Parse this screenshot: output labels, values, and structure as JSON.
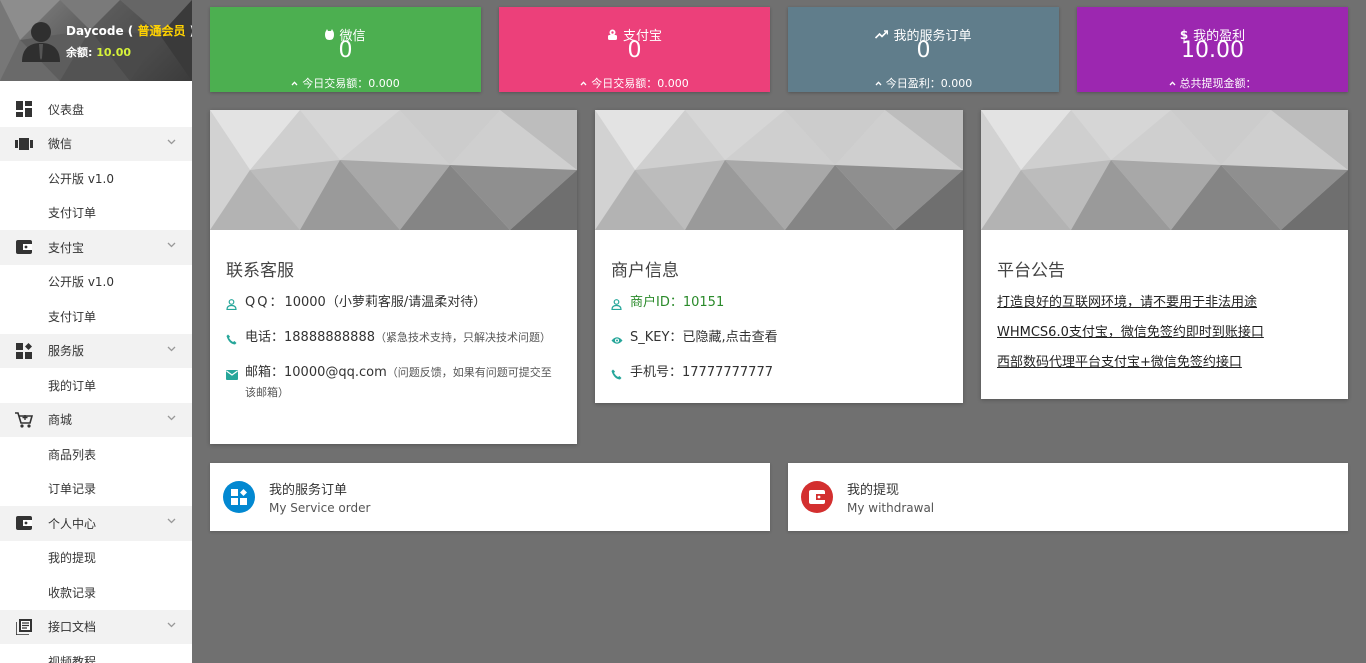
{
  "user": {
    "name": "Daycode",
    "paren_open": " ( ",
    "level": "普通会员",
    "paren_close": " )",
    "balance_label": "余额: ",
    "balance_value": "10.00"
  },
  "sidebar": {
    "items": [
      {
        "label": "仪表盘",
        "icon": "dashboard-icon"
      },
      {
        "label": "微信",
        "icon": "wechat-icon"
      },
      {
        "label": "公开版 v1.0"
      },
      {
        "label": "支付订单"
      },
      {
        "label": "支付宝",
        "icon": "wallet-icon"
      },
      {
        "label": "公开版 v1.0"
      },
      {
        "label": "支付订单"
      },
      {
        "label": "服务版",
        "icon": "widgets-icon"
      },
      {
        "label": "我的订单"
      },
      {
        "label": "商城",
        "icon": "cart-icon"
      },
      {
        "label": "商品列表"
      },
      {
        "label": "订单记录"
      },
      {
        "label": "个人中心",
        "icon": "wallet-icon"
      },
      {
        "label": "我的提现"
      },
      {
        "label": "收款记录"
      },
      {
        "label": "接口文档",
        "icon": "library-icon"
      },
      {
        "label": "视频教程"
      }
    ]
  },
  "tiles": [
    {
      "title": "微信",
      "value": "0",
      "sub": "今日交易额：0.000",
      "color": "#4caf50",
      "icon": "wechat-icon"
    },
    {
      "title": "支付宝",
      "value": "0",
      "sub": "今日交易额：0.000",
      "color": "#ec407a",
      "icon": "alipay-icon"
    },
    {
      "title": "我的服务订单",
      "value": "0",
      "sub": "今日盈利：0.000",
      "color": "#607d8b",
      "icon": "trending-up-icon"
    },
    {
      "title": "我的盈利",
      "value": "10.00",
      "sub": "总共提现金额：",
      "color": "#9c27b0",
      "icon": "dollar-icon"
    }
  ],
  "contact": {
    "title": "联系客服",
    "qq_label": "QQ：",
    "qq_value": "10000（小萝莉客服/请温柔对待）",
    "phone_label": "电话：",
    "phone_value": "18888888888",
    "phone_note": "（紧急技术支持，只解决技术问题）",
    "email_label": "邮箱：",
    "email_value": "10000@qq.com",
    "email_note": "（问题反馈，如果有问题可提交至该邮箱）"
  },
  "merchant": {
    "title": "商户信息",
    "id_label": "商户ID：",
    "id_value": "10151",
    "key_label": "S_KEY：",
    "key_value": "已隐藏,点击查看",
    "mobile_label": "手机号：",
    "mobile_value": "17777777777"
  },
  "notice": {
    "title": "平台公告",
    "links": [
      "打造良好的互联网环境，请不要用于非法用途",
      "WHMCS6.0支付宝，微信免签约即时到账接口",
      "西部数码代理平台支付宝+微信免签约接口"
    ]
  },
  "quick": [
    {
      "title": "我的服务订单",
      "subtitle": "My Service order",
      "color": "#0288d1",
      "icon": "widgets-icon"
    },
    {
      "title": "我的提现",
      "subtitle": "My withdrawal",
      "color": "#d32f2f",
      "icon": "wallet-icon"
    }
  ]
}
